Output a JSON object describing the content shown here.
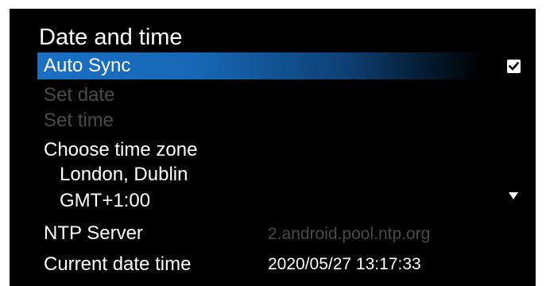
{
  "page": {
    "title": "Date and time"
  },
  "menu": {
    "auto_sync": {
      "label": "Auto Sync",
      "checked": true
    },
    "set_date": {
      "label": "Set date",
      "enabled": false
    },
    "set_time": {
      "label": "Set time",
      "enabled": false
    }
  },
  "time_zone": {
    "label": "Choose time zone",
    "city": "London, Dublin",
    "offset": "GMT+1:00"
  },
  "ntp": {
    "label": "NTP Server",
    "placeholder": "2.android.pool.ntp.org"
  },
  "current": {
    "label": "Current date time",
    "value": "2020/05/27 13:17:33"
  },
  "colors": {
    "background": "#000000",
    "accent": "#1a6fc4",
    "text": "#ffffff",
    "disabled_text": "#4a4a4a"
  },
  "icons": {
    "checkbox": "check-icon",
    "dropdown": "triangle-down-icon"
  }
}
